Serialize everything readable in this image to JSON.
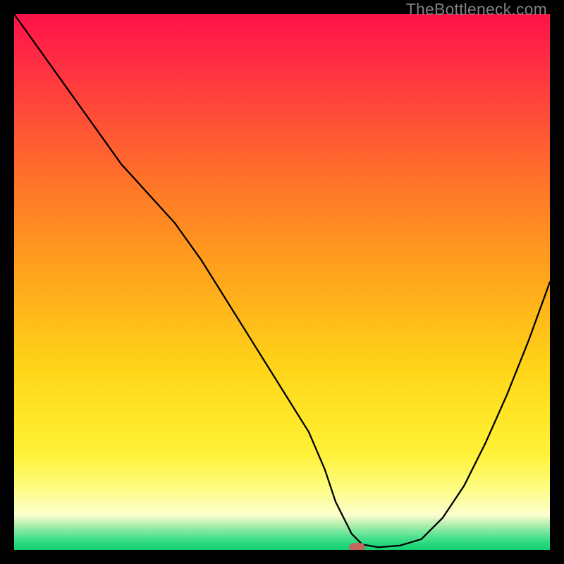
{
  "watermark": "TheBottleneck.com",
  "chart_data": {
    "type": "line",
    "title": "",
    "xlabel": "",
    "ylabel": "",
    "xlim": [
      0,
      100
    ],
    "ylim": [
      0,
      100
    ],
    "grid": false,
    "legend": false,
    "annotations": [],
    "series": [
      {
        "name": "curve",
        "color": "#000000",
        "x": [
          0,
          5,
          10,
          15,
          20,
          25,
          30,
          35,
          40,
          45,
          50,
          55,
          58,
          60,
          63,
          65,
          68,
          72,
          76,
          80,
          84,
          88,
          92,
          96,
          100
        ],
        "y": [
          100,
          93,
          86,
          79,
          72,
          66.5,
          61,
          54,
          46,
          38,
          30,
          22,
          15,
          9,
          3,
          1,
          0.5,
          0.8,
          2,
          6,
          12,
          20,
          29,
          39,
          50
        ]
      }
    ],
    "marker": {
      "x": 64,
      "y": 0.5,
      "color": "#c7655f",
      "shape": "rounded-rect"
    }
  }
}
